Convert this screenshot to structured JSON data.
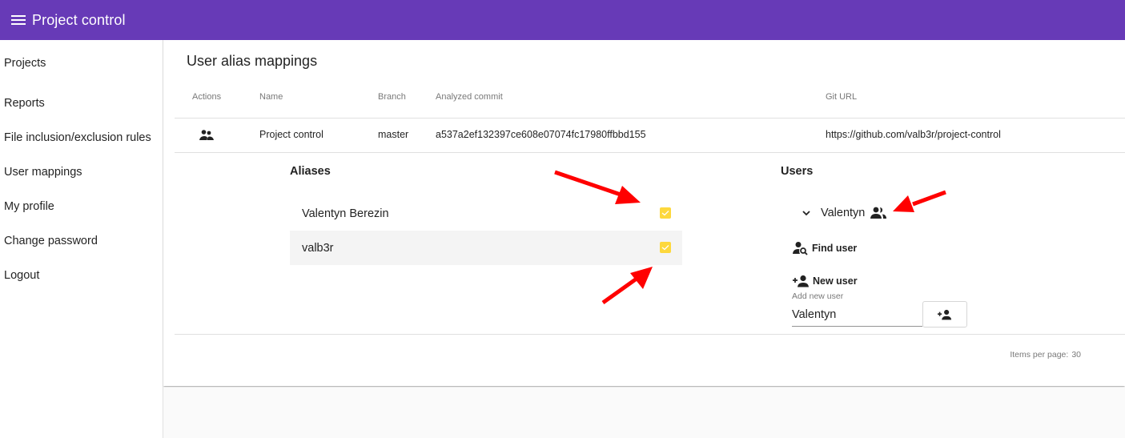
{
  "app": {
    "title": "Project control",
    "menu_icon": "menu-icon",
    "brand_color": "#673ab7"
  },
  "sidebar": {
    "items": [
      {
        "label": "Projects"
      },
      {
        "label": "Reports"
      },
      {
        "label": "File inclusion/exclusion rules"
      },
      {
        "label": "User mappings"
      },
      {
        "label": "My profile"
      },
      {
        "label": "Change password"
      },
      {
        "label": "Logout"
      }
    ]
  },
  "page": {
    "title": "User alias mappings"
  },
  "table": {
    "columns": [
      "Actions",
      "Name",
      "Branch",
      "Analyzed commit",
      "Git URL"
    ],
    "rows": [
      {
        "action_icon": "group-icon",
        "name": "Project control",
        "branch": "master",
        "commit": "a537a2ef132397ce608e07074fc17980ffbbd155",
        "git_url": "https://github.com/valb3r/project-control"
      }
    ]
  },
  "aliases": {
    "title": "Aliases",
    "items": [
      {
        "name": "Valentyn Berezin",
        "checked": true
      },
      {
        "name": "valb3r",
        "checked": true
      }
    ],
    "checkbox_color": "#fdd83d"
  },
  "users": {
    "title": "Users",
    "tree": [
      {
        "name": "Valentyn",
        "expanded": true,
        "icon": "group-icon"
      }
    ],
    "find_user_label": "Find user",
    "new_user_label": "New user",
    "new_user_input_label": "Add new user",
    "new_user_input_value": "Valentyn"
  },
  "paginator": {
    "label": "Items per page:",
    "value": "30"
  },
  "annotations": {
    "arrow_color": "#ff0000",
    "arrow_count": 3
  }
}
